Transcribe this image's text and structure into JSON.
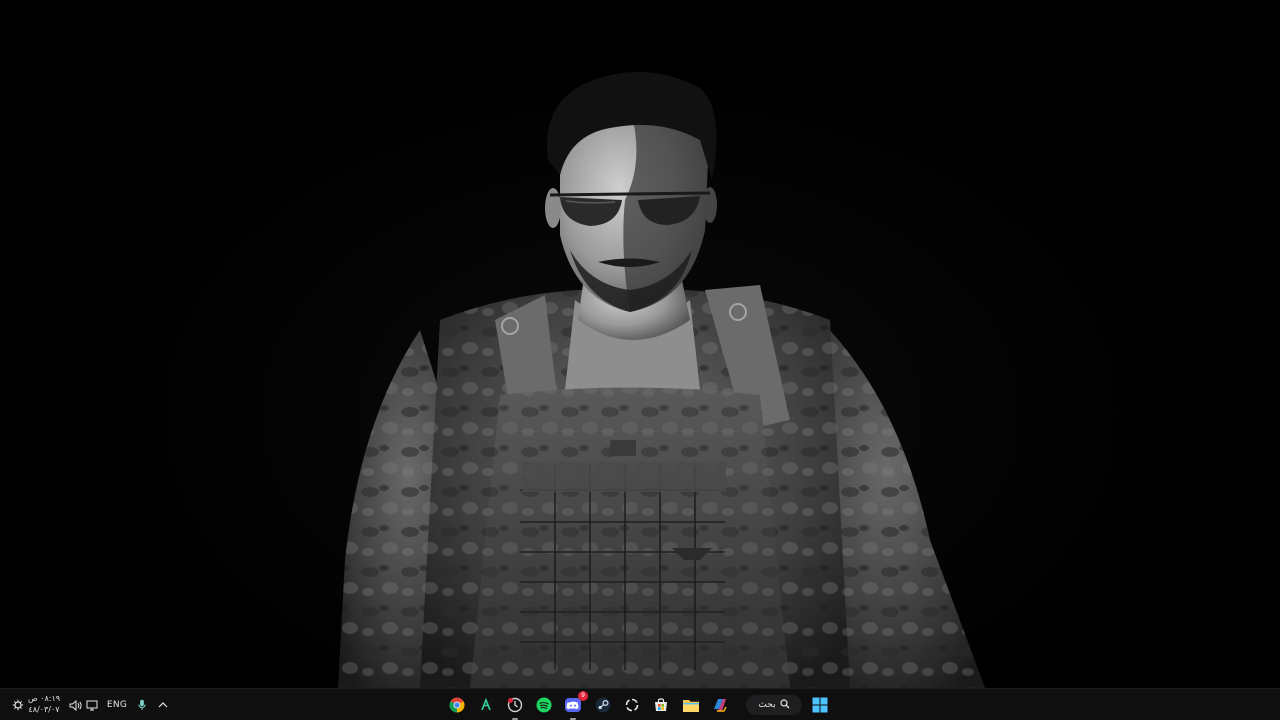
{
  "taskbar": {
    "search_label": "بحث",
    "language": "ENG",
    "clock_time": "٠٨:١٩ ص",
    "clock_date": "٤٨/٠٣/٠٧",
    "apps": [
      {
        "name": "chrome",
        "icon": "chrome-icon"
      },
      {
        "name": "app-a",
        "icon": "lambda-app-icon"
      },
      {
        "name": "app-clock",
        "icon": "clock-app-icon"
      },
      {
        "name": "spotify",
        "icon": "spotify-icon"
      },
      {
        "name": "discord",
        "icon": "discord-icon",
        "badge": "9"
      },
      {
        "name": "steam",
        "icon": "steam-icon"
      },
      {
        "name": "app-ring",
        "icon": "ring-app-icon"
      },
      {
        "name": "store",
        "icon": "store-icon"
      },
      {
        "name": "file-explorer",
        "icon": "folder-icon"
      },
      {
        "name": "copilot",
        "icon": "copilot-icon"
      }
    ]
  },
  "colors": {
    "taskbar_bg": "#0f0f10",
    "accent_start": "#4cc2ff",
    "spotify": "#1ed760",
    "discord": "#5865f2",
    "folder": "#f2c14e",
    "badge": "#e0243a"
  }
}
